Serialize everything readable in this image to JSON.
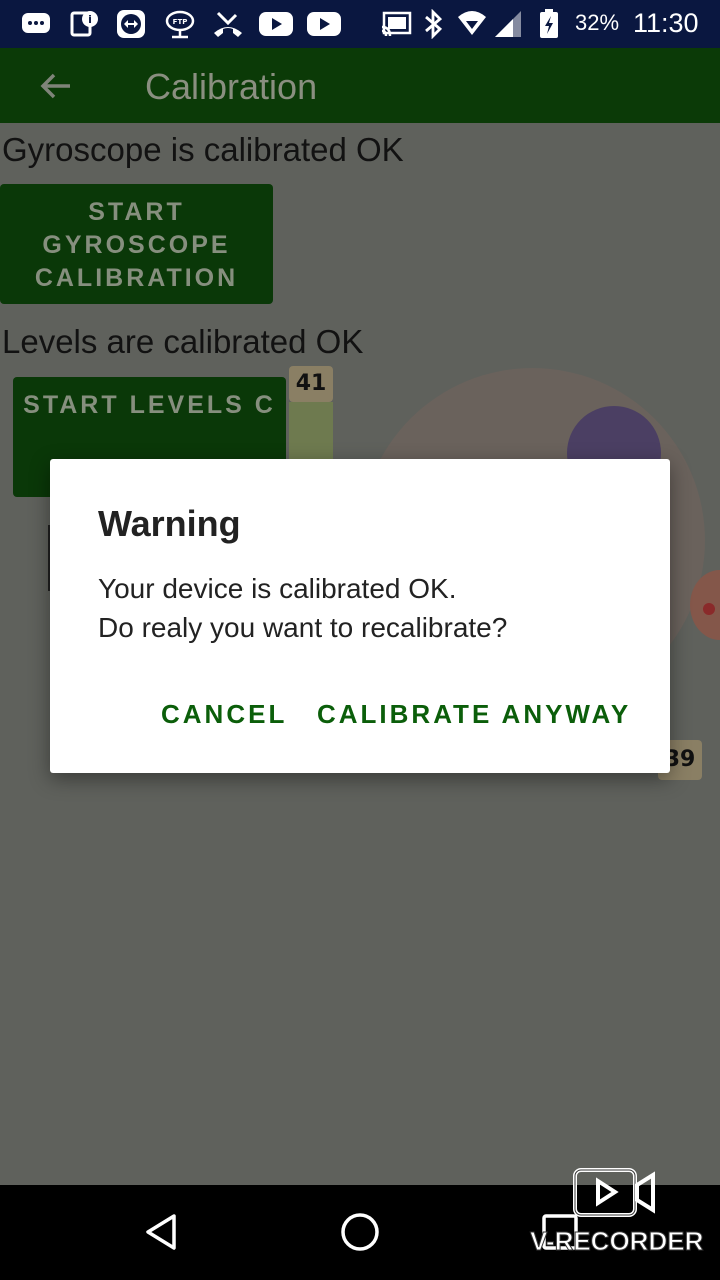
{
  "status_bar": {
    "battery": "32%",
    "time": "11:30",
    "icons": [
      "chat-icon",
      "info-icon",
      "teamviewer-icon",
      "ftp-cloud-icon",
      "missed-call-icon",
      "youtube-icon",
      "youtube-icon",
      "cast-icon",
      "bluetooth-icon",
      "wifi-icon",
      "signal-icon",
      "battery-charging-icon"
    ]
  },
  "app_bar": {
    "title": "Calibration",
    "back_icon": "arrow-left-icon"
  },
  "content": {
    "gyro_status": "Gyroscope is calibrated OK",
    "gyro_button": "START GYROSCOPE CALIBRATION",
    "levels_status": "Levels are calibrated OK",
    "levels_button": "START LEVELS C",
    "level_readout_top": "41",
    "level_readout_right": "39"
  },
  "dialog": {
    "title": "Warning",
    "message_line1": "Your device is calibrated OK.",
    "message_line2": "Do realy you want to recalibrate?",
    "cancel": "CANCEL",
    "confirm": "CALIBRATE ANYWAY"
  },
  "nav_bar": {
    "icons": [
      "back-triangle-icon",
      "home-circle-icon",
      "recents-square-icon"
    ]
  },
  "watermark": {
    "text": "V-RECORDER"
  },
  "colors": {
    "status_bar": "#0a1740",
    "app_bar": "#0b3a07",
    "accent": "#0b5e0a",
    "dialog_bg": "#ffffff"
  }
}
